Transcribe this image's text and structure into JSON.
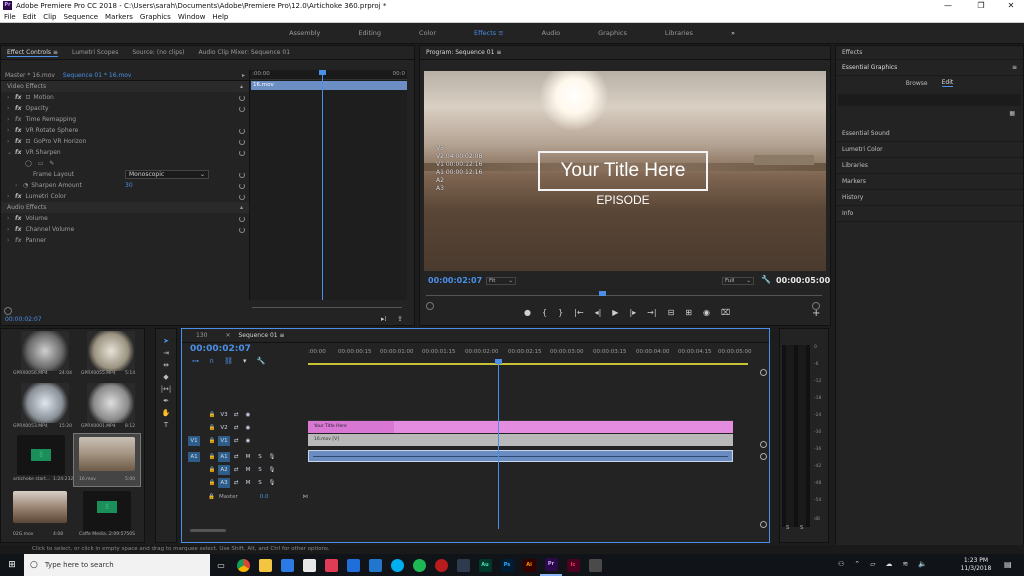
{
  "window": {
    "title": "Adobe Premiere Pro CC 2018 - C:\\Users\\sarah\\Documents\\Adobe\\Premiere Pro\\12.0\\Artichoke 360.prproj *",
    "logo": "Pr",
    "minimize": "—",
    "restore": "❐",
    "close": "✕"
  },
  "menu": [
    "File",
    "Edit",
    "Clip",
    "Sequence",
    "Markers",
    "Graphics",
    "Window",
    "Help"
  ],
  "workspaces": {
    "items": [
      "Assembly",
      "Editing",
      "Color",
      "Effects",
      "Audio",
      "Graphics",
      "Libraries"
    ],
    "active": "Effects",
    "menu_icon": "≡",
    "more": "»"
  },
  "effect_controls": {
    "tabs": [
      "Effect Controls",
      "Lumetri Scopes",
      "Source: (no clips)",
      "Audio Clip Mixer: Sequence 01"
    ],
    "menu_icon": "≡",
    "master_label": "Master * 16.mov",
    "sequence_label": "Sequence 01 * 16.mov",
    "ruler_start": ":00:00",
    "ruler_end": "00:0",
    "clip_name": "16.mov",
    "video_effects_header": "Video Effects",
    "effects": [
      {
        "name": "Motion",
        "fx": true,
        "icon": true
      },
      {
        "name": "Opacity",
        "fx": true
      },
      {
        "name": "Time Remapping",
        "fx": true
      },
      {
        "name": "VR Rotate Sphere",
        "fx": true
      },
      {
        "name": "GoPro VR Horizon",
        "fx": true,
        "icon": true
      },
      {
        "name": "VR Sharpen",
        "fx": true,
        "expanded": true
      }
    ],
    "frame_layout_label": "Frame Layout",
    "frame_layout_value": "Monoscopic",
    "sharpen_label": "Sharpen Amount",
    "sharpen_value": "30",
    "lumetri": "Lumetri Color",
    "audio_effects_header": "Audio Effects",
    "audio_effects": [
      "Volume",
      "Channel Volume",
      "Panner"
    ],
    "timecode": "00:00:02:07"
  },
  "program": {
    "title": "Program: Sequence 01",
    "menu_icon": "≡",
    "overlay_lines": [
      "V3",
      "V2 04 00:02:08",
      "V1 00:00:12:16",
      "A1 00:00 12:16",
      "A2",
      "A3"
    ],
    "title_text": "Your Title Here",
    "episode_text": "EPISODE",
    "timecode": "00:00:02:07",
    "fit": "Fit",
    "full": "Full",
    "duration": "00:00:05:00",
    "controls": [
      "●",
      "{",
      "}",
      "|←",
      "◂|",
      "▶",
      "|▸",
      "→|",
      "⊟",
      "⊞",
      "◉",
      "⌧",
      "+"
    ]
  },
  "essential_graphics": {
    "effects_tab": "Effects",
    "title": "Essential Graphics",
    "menu_icon": "≡",
    "browse": "Browse",
    "edit": "Edit",
    "panels": [
      "Essential Sound",
      "Lumetri Color",
      "Libraries",
      "Markers",
      "History",
      "Info"
    ]
  },
  "project": {
    "items": [
      {
        "name": "GPRX0056.MP4",
        "dur": "24:04",
        "kind": "sphere"
      },
      {
        "name": "GPRX0055.MP4",
        "dur": "5:14",
        "kind": "sphere"
      },
      {
        "name": "GPRX0053.MP4",
        "dur": "15:20",
        "kind": "sphere"
      },
      {
        "name": "GPRX0001.MP4",
        "dur": "8:12",
        "kind": "sphere"
      },
      {
        "name": "artichoke start...",
        "dur": "1:24:2320",
        "kind": "audio"
      },
      {
        "name": "16.mov",
        "dur": "5:00",
        "kind": "video"
      },
      {
        "name": "02G.mov",
        "dur": "4:08",
        "kind": "landscape"
      },
      {
        "name": "Caffe Media...",
        "dur": "2:09:5750S",
        "kind": "audio"
      }
    ]
  },
  "timeline": {
    "tabs": [
      "130",
      "Sequence 01"
    ],
    "menu_icon": "≡",
    "timecode": "00:00:02:07",
    "ruler_labels": [
      ":00:00",
      "00:00:00:15",
      "00:00:01:00",
      "00:00:01:15",
      "00:00:02:00",
      "00:00:02:15",
      "00:00:03:00",
      "00:00:03:15",
      "00:00:04:00",
      "00:00:04:15",
      "00:00:05:00"
    ],
    "video_tracks": [
      {
        "src": "",
        "name": "V3"
      },
      {
        "src": "",
        "name": "V2"
      },
      {
        "src": "V1",
        "name": "V1"
      }
    ],
    "audio_tracks": [
      {
        "src": "A1",
        "name": "A1"
      },
      {
        "src": "",
        "name": "A2"
      },
      {
        "src": "",
        "name": "A3"
      }
    ],
    "mute": "M",
    "solo": "S",
    "master_label": "Master",
    "master_value": "0.0",
    "clips": {
      "v2": "Your Title Here",
      "v1": "16.mov [V]"
    }
  },
  "meter": {
    "labels": [
      "0",
      "-6",
      "-12",
      "-18",
      "-24",
      "-30",
      "-36",
      "-42",
      "-48",
      "-54",
      "dB"
    ],
    "solo_left": "S",
    "solo_right": "S"
  },
  "status_bar": "Click to select, or click in empty space and drag to marquee select. Use Shift, Alt, and Ctrl for other options.",
  "taskbar": {
    "search_placeholder": "Type here to search",
    "apps": [
      {
        "label": "",
        "bg": "#3a3f4a",
        "fg": "#fff"
      },
      {
        "label": "",
        "bg": "#d94b3a",
        "fg": "#fff"
      },
      {
        "label": "",
        "bg": "#2c7be5",
        "fg": "#fff"
      },
      {
        "label": "",
        "bg": "#f4c542",
        "fg": "#000"
      },
      {
        "label": "",
        "bg": "#0a66c2",
        "fg": "#fff"
      },
      {
        "label": "",
        "bg": "#e03c56",
        "fg": "#fff"
      },
      {
        "label": "",
        "bg": "#1e6fd9",
        "fg": "#fff"
      },
      {
        "label": "",
        "bg": "#2277cc",
        "fg": "#fff"
      },
      {
        "label": "",
        "bg": "#00aff0",
        "fg": "#fff"
      },
      {
        "label": "",
        "bg": "#1db954",
        "fg": "#000"
      },
      {
        "label": "",
        "bg": "#b81c1c",
        "fg": "#fff"
      },
      {
        "label": "",
        "bg": "#2e3b4e",
        "fg": "#fff"
      },
      {
        "label": "Au",
        "bg": "#00382b",
        "fg": "#4de3b0"
      },
      {
        "label": "Ps",
        "bg": "#001d34",
        "fg": "#31a8ff"
      },
      {
        "label": "Ai",
        "bg": "#330000",
        "fg": "#ff9a00"
      },
      {
        "label": "Pr",
        "bg": "#2a0a4a",
        "fg": "#d8a8ff"
      },
      {
        "label": "Ic",
        "bg": "#49021f",
        "fg": "#ff3366"
      },
      {
        "label": "",
        "bg": "#4a4a4a",
        "fg": "#fff"
      }
    ],
    "time": "1:23 PM",
    "date": "11/3/2018"
  }
}
